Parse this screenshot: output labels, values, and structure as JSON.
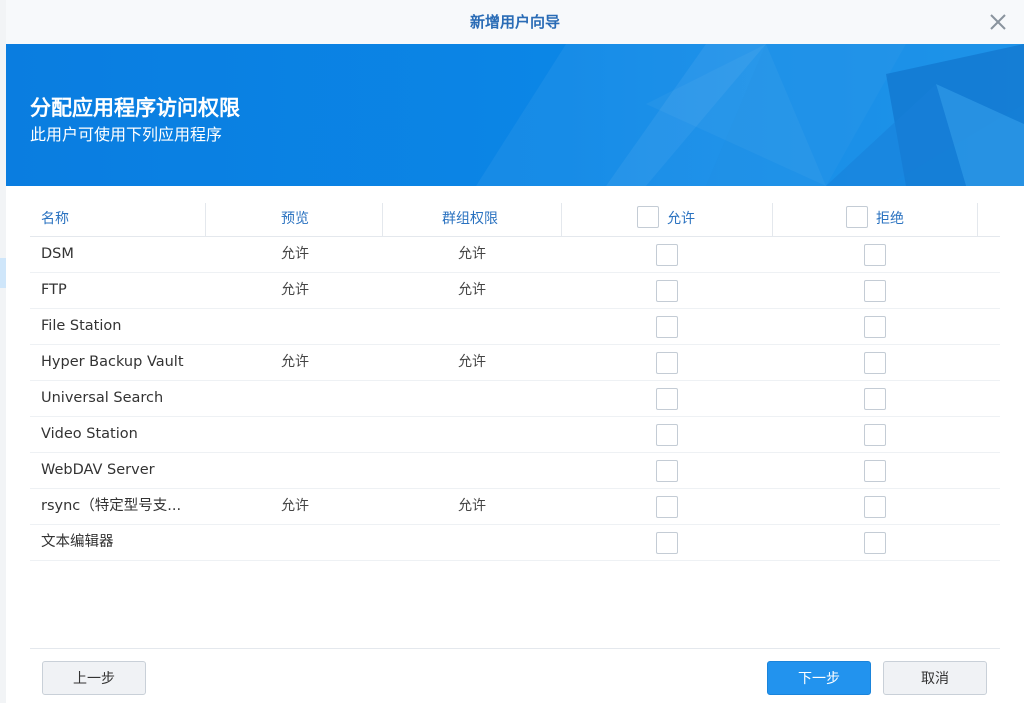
{
  "dialog": {
    "title": "新增用户向导"
  },
  "banner": {
    "title": "分配应用程序访问权限",
    "subtitle": "此用户可使用下列应用程序"
  },
  "table": {
    "headers": {
      "name": "名称",
      "preview": "预览",
      "group_permission": "群组权限",
      "allow": "允许",
      "deny": "拒绝"
    },
    "rows": [
      {
        "name": "DSM",
        "preview": "允许",
        "group": "允许",
        "allow": false,
        "deny": false
      },
      {
        "name": "FTP",
        "preview": "允许",
        "group": "允许",
        "allow": false,
        "deny": false
      },
      {
        "name": "File Station",
        "preview": "",
        "group": "",
        "allow": false,
        "deny": false
      },
      {
        "name": "Hyper Backup Vault",
        "preview": "允许",
        "group": "允许",
        "allow": false,
        "deny": false
      },
      {
        "name": "Universal Search",
        "preview": "",
        "group": "",
        "allow": false,
        "deny": false
      },
      {
        "name": "Video Station",
        "preview": "",
        "group": "",
        "allow": false,
        "deny": false
      },
      {
        "name": "WebDAV Server",
        "preview": "",
        "group": "",
        "allow": false,
        "deny": false
      },
      {
        "name": "rsync（特定型号支...",
        "preview": "允许",
        "group": "允许",
        "allow": false,
        "deny": false
      },
      {
        "name": "文本编辑器",
        "preview": "",
        "group": "",
        "allow": false,
        "deny": false
      }
    ]
  },
  "footer": {
    "prev_label": "上一步",
    "next_label": "下一步",
    "cancel_label": "取消"
  },
  "icons": {
    "close": "close-icon"
  },
  "colors": {
    "accent": "#2a72c0",
    "banner": "#0a7de0",
    "primary_button": "#2293ee"
  }
}
